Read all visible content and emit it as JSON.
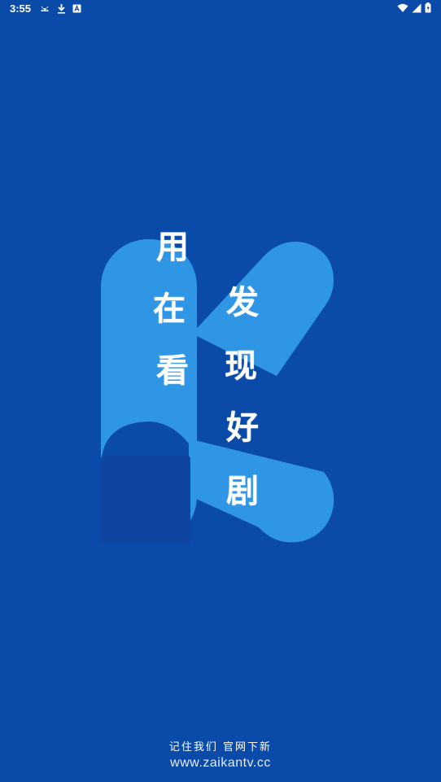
{
  "status_bar": {
    "time": "3:55",
    "left_icons": [
      "android-debug-icon",
      "download-icon",
      "app-notification-icon"
    ],
    "right_icons": [
      "wifi-icon",
      "cell-signal-icon",
      "battery-icon"
    ]
  },
  "splash": {
    "logo_letter": "K",
    "slogan_left": [
      "用",
      "在",
      "看"
    ],
    "slogan_right": [
      "发",
      "现",
      "好",
      "剧"
    ]
  },
  "footer": {
    "tagline": "记住我们 官网下新",
    "url": "www.zaikantv.cc"
  },
  "colors": {
    "background": "#0a4aa8",
    "logo": "#2f96e6",
    "text": "#ffffff"
  }
}
